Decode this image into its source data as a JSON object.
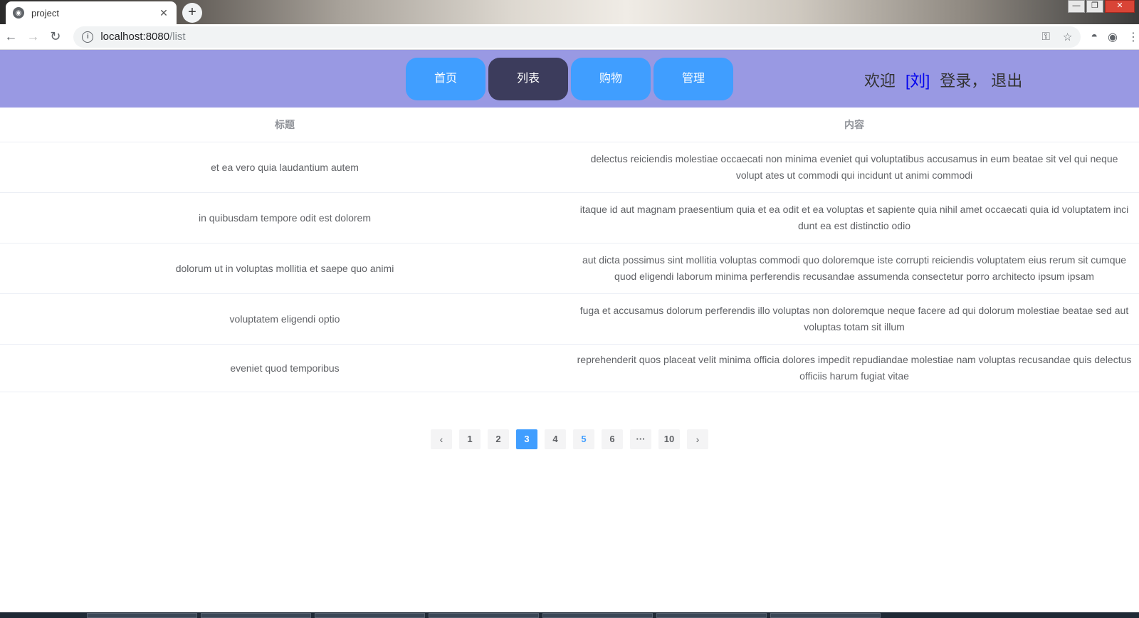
{
  "browser": {
    "tab_title": "project",
    "url_host": "localhost:8080",
    "url_path": "/list",
    "new_tab": "+",
    "win_minimize": "—",
    "win_restore": "❐",
    "win_close": "✕"
  },
  "nav": {
    "items": [
      {
        "label": "首页",
        "active": false
      },
      {
        "label": "列表",
        "active": true
      },
      {
        "label": "购物",
        "active": false
      },
      {
        "label": "管理",
        "active": false
      }
    ]
  },
  "user": {
    "welcome": "欢迎",
    "name": "[刘]",
    "login": "登录，",
    "logout": "退出"
  },
  "table": {
    "headers": [
      "标题",
      "内容"
    ],
    "rows": [
      {
        "title": "et ea vero quia laudantium autem",
        "content": "delectus reiciendis molestiae occaecati non minima eveniet qui voluptatibus accusamus in eum beatae sit vel qui neque volupt ates ut commodi qui incidunt ut animi commodi"
      },
      {
        "title": "in quibusdam tempore odit est dolorem",
        "content": "itaque id aut magnam praesentium quia et ea odit et ea voluptas et sapiente quia nihil amet occaecati quia id voluptatem inci dunt ea est distinctio odio"
      },
      {
        "title": "dolorum ut in voluptas mollitia et saepe quo animi",
        "content": "aut dicta possimus sint mollitia voluptas commodi quo doloremque iste corrupti reiciendis voluptatem eius rerum sit cumque quod eligendi laborum minima perferendis recusandae assumenda consectetur porro architecto ipsum ipsam"
      },
      {
        "title": "voluptatem eligendi optio",
        "content": "fuga et accusamus dolorum perferendis illo voluptas non doloremque neque facere ad qui dolorum molestiae beatae sed aut voluptas totam sit illum"
      },
      {
        "title": "eveniet quod temporibus",
        "content": "reprehenderit quos placeat velit minima officia dolores impedit repudiandae molestiae nam voluptas recusandae quis delectus officiis harum fugiat vitae"
      }
    ]
  },
  "pagination": {
    "prev": "‹",
    "next": "›",
    "pages": [
      "1",
      "2",
      "3",
      "4",
      "5",
      "6",
      "···",
      "10"
    ],
    "current": "3",
    "hover": "5"
  },
  "colors": {
    "header_bg": "#9999e3",
    "nav_button": "#409eff",
    "nav_active": "#3c3c5c",
    "user_name": "#0000ee"
  }
}
